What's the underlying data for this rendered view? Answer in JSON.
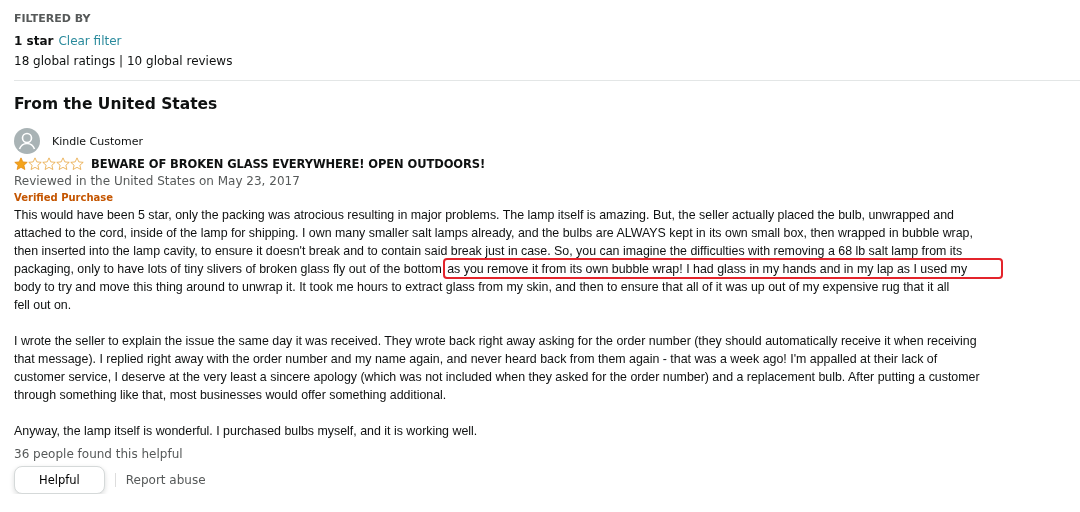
{
  "filter": {
    "heading": "FILTERED BY",
    "value": "1 star",
    "clear_link": "Clear filter",
    "summary": "18 global ratings | 10 global reviews"
  },
  "section_title": "From the United States",
  "review": {
    "author": "Kindle Customer",
    "stars": 1,
    "title": "BEWARE OF BROKEN GLASS EVERYWHERE! OPEN OUTDOORS!",
    "date": "Reviewed in the United States on May 23, 2017",
    "badge": "Verified Purchase",
    "paragraphs": [
      {
        "lines": [
          [
            {
              "text": "This would have been 5 star, only the packing was atrocious resulting in major problems. The lamp itself is amazing. But, the seller actually placed the bulb, unwrapped and",
              "highlighted": false
            }
          ],
          [
            {
              "text": "attached to the cord, inside of the lamp for shipping. I own many smaller salt lamps already, and the bulbs are ALWAYS kept in its own small box, then wrapped in bubble wrap,",
              "highlighted": false
            }
          ],
          [
            {
              "text": "then inserted into the lamp cavity, to ensure it doesn't break and to contain said break just in case. So, you can imagine the difficulties with removing a 68 lb salt lamp from its",
              "highlighted": false
            }
          ],
          [
            {
              "text": "packaging, only to have lots of tiny slivers of broken glass fly out of the bottom",
              "highlighted": false
            },
            {
              "text": "as you remove it from its own bubble wrap! I had glass in my hands and in my lap as I used my",
              "highlighted": true
            }
          ],
          [
            {
              "text": "body to try and move this thing around to unwrap it. It took me hours to extract glass from my skin, and then to ensure that all of it was up out of my expensive rug that it all",
              "highlighted": false
            }
          ],
          [
            {
              "text": "fell out on.",
              "highlighted": false
            }
          ]
        ]
      },
      {
        "lines": [
          [
            {
              "text": "I wrote the seller to explain the issue the same day it was received. They wrote back right away asking for the order number (they should automatically receive it when receiving",
              "highlighted": false
            }
          ],
          [
            {
              "text": "that message). I replied right away with the order number and my name again, and never heard back from them again - that was a week ago! I'm appalled at their lack of",
              "highlighted": false
            }
          ],
          [
            {
              "text": "customer service, I deserve at the very least a sincere apology (which was not included when they asked for the order number) and a replacement bulb. After putting a customer",
              "highlighted": false
            }
          ],
          [
            {
              "text": "through something like that, most businesses would offer something additional.",
              "highlighted": false
            }
          ]
        ]
      },
      {
        "lines": [
          [
            {
              "text": "Anyway, the lamp itself is wonderful. I purchased bulbs myself, and it is working well.",
              "highlighted": false
            }
          ]
        ]
      }
    ],
    "helpful_count": "36 people found this helpful",
    "helpful_button": "Helpful",
    "report_link": "Report abuse"
  }
}
